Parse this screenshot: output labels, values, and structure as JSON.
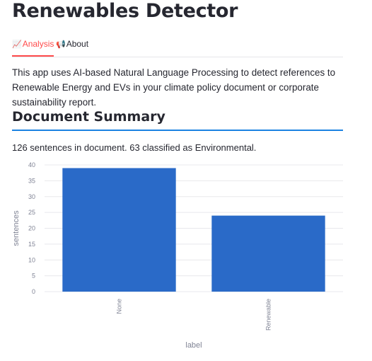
{
  "app": {
    "title": "Renewables Detector"
  },
  "tabs": [
    {
      "icon": "📈",
      "icon_name": "chart-increasing-icon",
      "label": "Analysis",
      "active": true
    },
    {
      "icon": "📢",
      "icon_name": "loudspeaker-icon",
      "label": "About",
      "active": false
    }
  ],
  "intro": "This app uses AI-based Natural Language Processing to detect references to Renewable Energy and EVs in your climate policy document or corporate sustainability report.",
  "section": {
    "title": "Document Summary",
    "summary": "126 sentences in document. 63 classified as Environmental."
  },
  "colors": {
    "accent": "#ff4b4b",
    "section_rule": "#1c83e1",
    "bar": "#2a6ac8"
  },
  "chart_data": {
    "type": "bar",
    "categories": [
      "None",
      "Renewable"
    ],
    "values": [
      39,
      24
    ],
    "xlabel": "label",
    "ylabel": "sentences",
    "ylim": [
      0,
      40
    ],
    "yticks": [
      0,
      5,
      10,
      15,
      20,
      25,
      30,
      35,
      40
    ],
    "grid": true,
    "legend": "none"
  }
}
